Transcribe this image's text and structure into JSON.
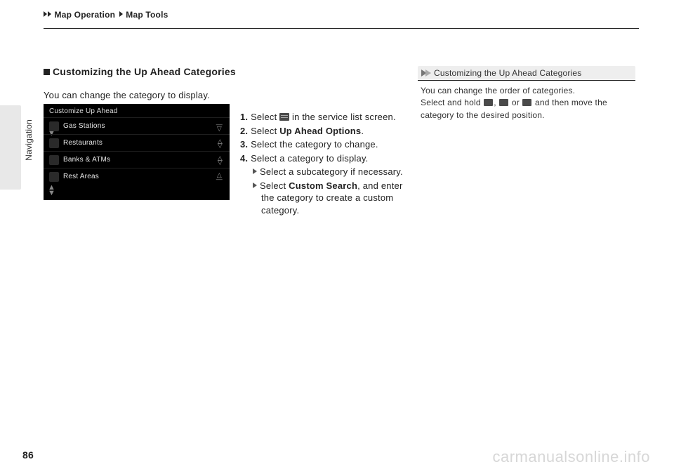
{
  "breadcrumb": {
    "a": "Map Operation",
    "b": "Map Tools"
  },
  "sidetab": "Navigation",
  "heading": "Customizing the Up Ahead Categories",
  "intro": "You can change the category to display.",
  "screenshot": {
    "title": "Customize Up Ahead",
    "rows": [
      "Gas Stations",
      "Restaurants",
      "Banks & ATMs",
      "Rest Areas"
    ]
  },
  "steps": {
    "s1a": "1.",
    "s1b": "Select ",
    "s1c": " in the service list screen.",
    "s2a": "2.",
    "s2b": "Select ",
    "s2c": "Up Ahead Options",
    "s2d": ".",
    "s3a": "3.",
    "s3b": "Select the category to change.",
    "s4a": "4.",
    "s4b": "Select a category to display.",
    "sub1": "Select a subcategory if necessary.",
    "sub2a": "Select ",
    "sub2b": "Custom Search",
    "sub2c": ", and enter the category to create a custom category."
  },
  "tip": {
    "title": "Customizing the Up Ahead Categories",
    "line1": "You can change the order of categories.",
    "line2a": "Select and hold ",
    "line2b": ", ",
    "line2c": " or ",
    "line2d": " and then move the category to the desired position."
  },
  "page": "86",
  "watermark": "carmanualsonline.info"
}
